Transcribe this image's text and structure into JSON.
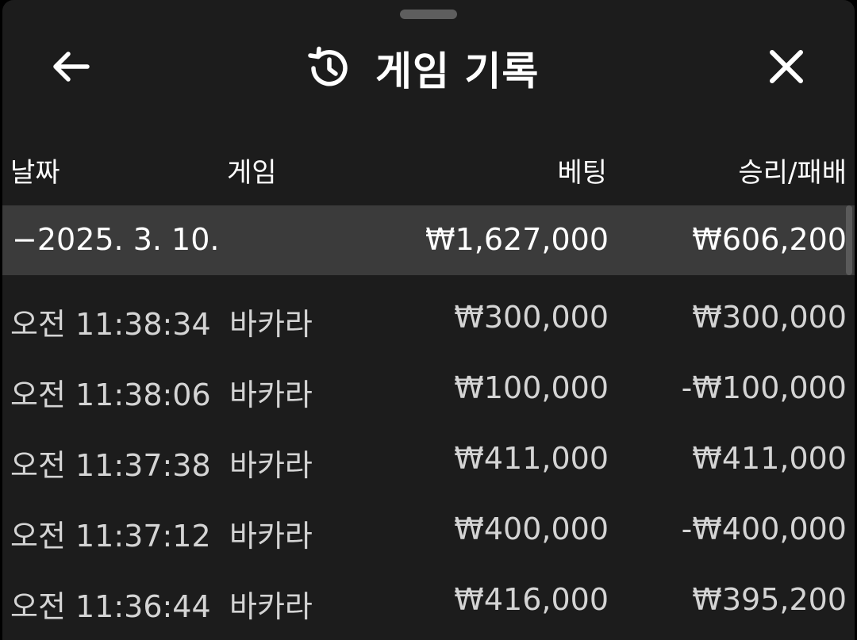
{
  "header": {
    "title": "게임 기록",
    "back_icon": "back-arrow-icon",
    "history_icon": "history-icon",
    "close_icon": "close-icon"
  },
  "columns": {
    "date": "날짜",
    "game": "게임",
    "bet": "베팅",
    "result": "승리/패배"
  },
  "date_group": {
    "toggle": "−",
    "date": "2025. 3. 10.",
    "bet_total": "₩1,627,000",
    "result_total": "₩606,200"
  },
  "rows": [
    {
      "time": "오전 11:38:34",
      "game": "바카라",
      "bet": "₩300,000",
      "result": "₩300,000"
    },
    {
      "time": "오전 11:38:06",
      "game": "바카라",
      "bet": "₩100,000",
      "result": "-₩100,000"
    },
    {
      "time": "오전 11:37:38",
      "game": "바카라",
      "bet": "₩411,000",
      "result": "₩411,000"
    },
    {
      "time": "오전 11:37:12",
      "game": "바카라",
      "bet": "₩400,000",
      "result": "-₩400,000"
    },
    {
      "time": "오전 11:36:44",
      "game": "바카라",
      "bet": "₩416,000",
      "result": "₩395,200"
    }
  ],
  "colors": {
    "background": "#1c1c1c",
    "highlight_row": "#3b3b3b",
    "text_primary": "#ffffff",
    "text_secondary": "#d4d4d4"
  }
}
